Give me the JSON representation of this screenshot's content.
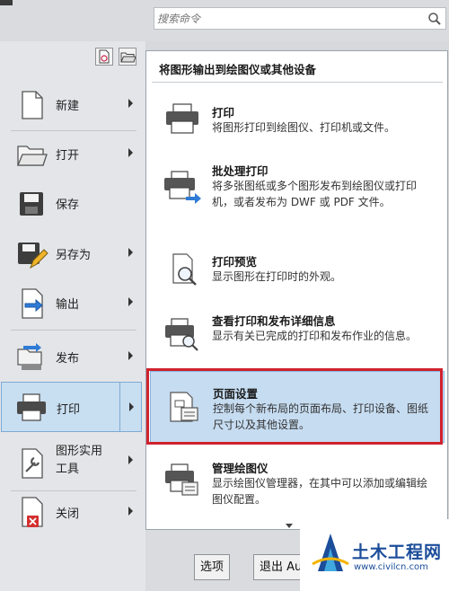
{
  "search": {
    "placeholder": "搜索命令",
    "icon": "search-icon"
  },
  "toolbar": {
    "icons": [
      "recent-documents-icon",
      "open-documents-icon"
    ]
  },
  "menu": {
    "items": [
      {
        "label": "新建",
        "icon": "new-file-icon",
        "has_submenu": true
      },
      {
        "label": "打开",
        "icon": "open-folder-icon",
        "has_submenu": true
      },
      {
        "label": "保存",
        "icon": "save-icon",
        "has_submenu": false
      },
      {
        "label": "另存为",
        "icon": "save-as-icon",
        "has_submenu": true
      },
      {
        "label": "输出",
        "icon": "export-icon",
        "has_submenu": true
      },
      {
        "label": "发布",
        "icon": "publish-icon",
        "has_submenu": true
      },
      {
        "label": "打印",
        "icon": "print-icon",
        "has_submenu": true,
        "active": true
      },
      {
        "label": "图形实用工具",
        "icon": "drawing-utilities-icon",
        "has_submenu": true
      },
      {
        "label": "关闭",
        "icon": "close-icon",
        "has_submenu": true
      }
    ]
  },
  "submenu": {
    "title": "将图形输出到绘图仪或其他设备",
    "items": [
      {
        "title": "打印",
        "desc": "将图形打印到绘图仪、打印机或文件。",
        "icon": "plot-icon"
      },
      {
        "title": "批处理打印",
        "desc": "将多张图纸或多个图形发布到绘图仪或打印机，或者发布为 DWF 或 PDF 文件。",
        "icon": "batch-plot-icon"
      },
      {
        "title": "打印预览",
        "desc": "显示图形在打印时的外观。",
        "icon": "plot-preview-icon"
      },
      {
        "title": "查看打印和发布详细信息",
        "desc": "显示有关已完成的打印和发布作业的信息。",
        "icon": "plot-details-icon"
      },
      {
        "title": "页面设置",
        "desc": "控制每个新布局的页面布局、打印设备、图纸尺寸以及其他设置。",
        "icon": "page-setup-icon",
        "highlighted": true
      },
      {
        "title": "管理绘图仪",
        "desc": "显示绘图仪管理器，在其中可以添加或编辑绘图仪配置。",
        "icon": "plotter-manager-icon"
      }
    ]
  },
  "buttons": {
    "options": "选项",
    "exit": "退出 Au"
  },
  "watermark": {
    "name": "土木工程网",
    "url": "www.civilcn.com"
  },
  "colors": {
    "highlight": "#c6dcf1",
    "annotation_box": "#d0222d",
    "brand": "#1b4d9a"
  }
}
